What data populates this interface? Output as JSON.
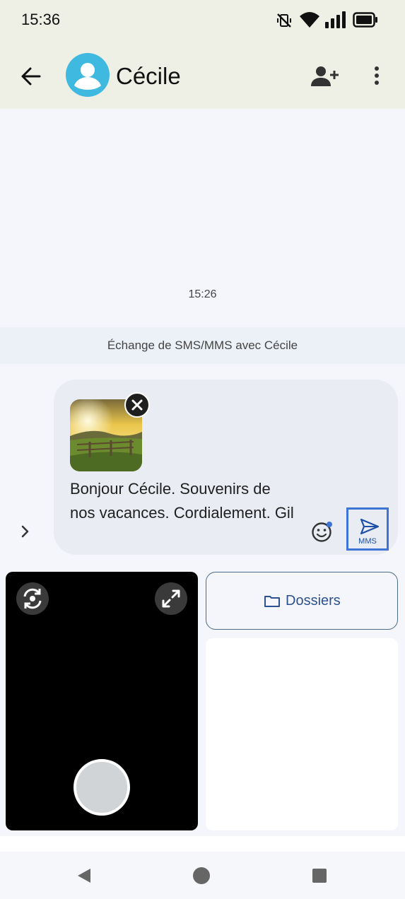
{
  "status_bar": {
    "time": "15:36",
    "icons": [
      "vibrate-off-icon",
      "wifi-icon",
      "signal-icon",
      "battery-icon"
    ]
  },
  "app_bar": {
    "contact_name": "Cécile",
    "icons": [
      "back-arrow-icon",
      "add-contact-icon",
      "more-vert-icon"
    ]
  },
  "conversation": {
    "timestamp": "15:26",
    "banner": "Échange de SMS/MMS avec Cécile"
  },
  "compose": {
    "message": "Bonjour Cécile. Souvenirs de nos vacances. Cordialement. Gil",
    "send_label": "MMS",
    "icons": [
      "chevron-right-icon",
      "close-icon",
      "emoji-icon",
      "send-icon"
    ]
  },
  "attachments": {
    "folders_label": "Dossiers"
  },
  "colors": {
    "accent": "#3d74d6",
    "avatar": "#3fb9e0",
    "header_bg": "#eef0e6",
    "camera_bg": "#000000"
  }
}
